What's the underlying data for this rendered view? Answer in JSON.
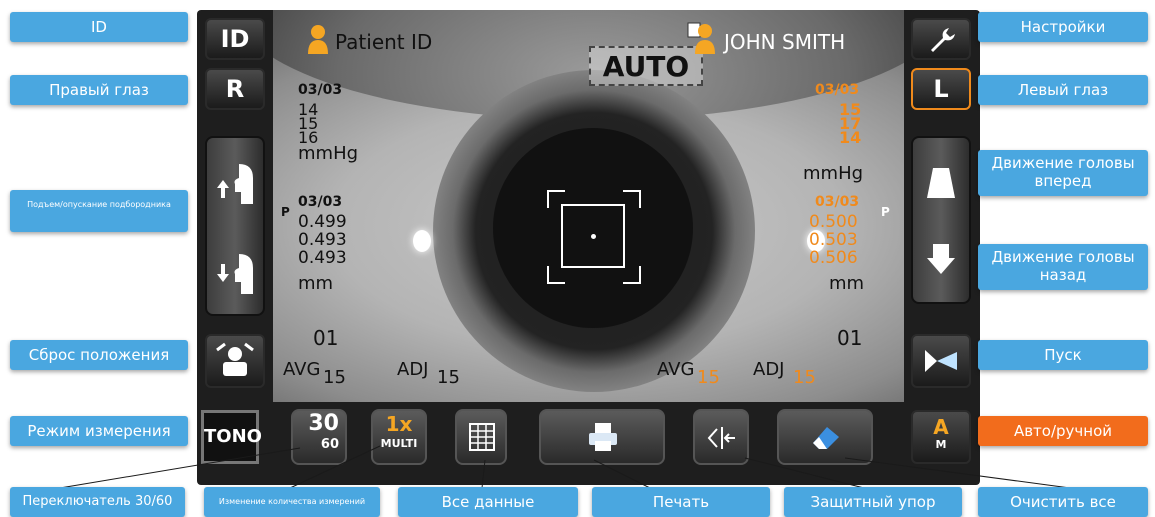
{
  "screen": {
    "auto_label": "AUTO",
    "patient_id_label": "Patient ID",
    "patient_name": "JOHN SMITH",
    "right_eye": {
      "count_top": "03/03",
      "iop": [
        "14",
        "15",
        "16"
      ],
      "iop_unit": "mmHg",
      "count_bottom": "03/03",
      "thickness": [
        "0.499",
        "0.493",
        "0.493"
      ],
      "thickness_unit": "mm",
      "index": "01",
      "avg_label": "AVG",
      "avg_value": "15",
      "adj_label": "ADJ",
      "adj_value": "15"
    },
    "left_eye": {
      "count_top": "03/03",
      "iop": [
        "15",
        "17",
        "14"
      ],
      "iop_unit": "mmHg",
      "count_bottom": "03/03",
      "thickness": [
        "0.500",
        "0.503",
        "0.506"
      ],
      "thickness_unit": "mm",
      "index": "01",
      "avg_label": "AVG",
      "avg_value": "15",
      "adj_label": "ADJ",
      "adj_value": "15"
    },
    "p_marker": "P",
    "buttons": {
      "id": "ID",
      "right": "R",
      "left": "L",
      "tono": "TONO",
      "switch_top": "30",
      "switch_bottom": "60",
      "multi_top": "1x",
      "multi_bottom": "MULTI",
      "auto_manual_top": "A",
      "auto_manual_bottom": "M"
    }
  },
  "callouts": {
    "id": "ID",
    "right_eye": "Правый глаз",
    "chin": "Подъем/опускание подбородника",
    "reset": "Сброс положения",
    "mode": "Режим измерения",
    "switch": "Переключатель 30/60",
    "count_change": "Изменение количества измерений",
    "all_data": "Все данные",
    "print": "Печать",
    "stop": "Защитный упор",
    "clear": "Очистить все",
    "settings": "Настройки",
    "left_eye": "Левый глаз",
    "head_forward": "Движение головы вперед",
    "head_back": "Движение головы назад",
    "start": "Пуск",
    "auto_manual": "Авто/ручной"
  },
  "colors": {
    "callout_blue": "#4aa7e0",
    "callout_active": "#f26c1c",
    "left_eye_values": "#f08a1c"
  },
  "icons": [
    "person-icon",
    "wrench-icon",
    "arrow-up-icon",
    "arrow-down-icon",
    "printer-icon",
    "eraser-icon",
    "table-icon",
    "start-icon",
    "reset-icon"
  ]
}
